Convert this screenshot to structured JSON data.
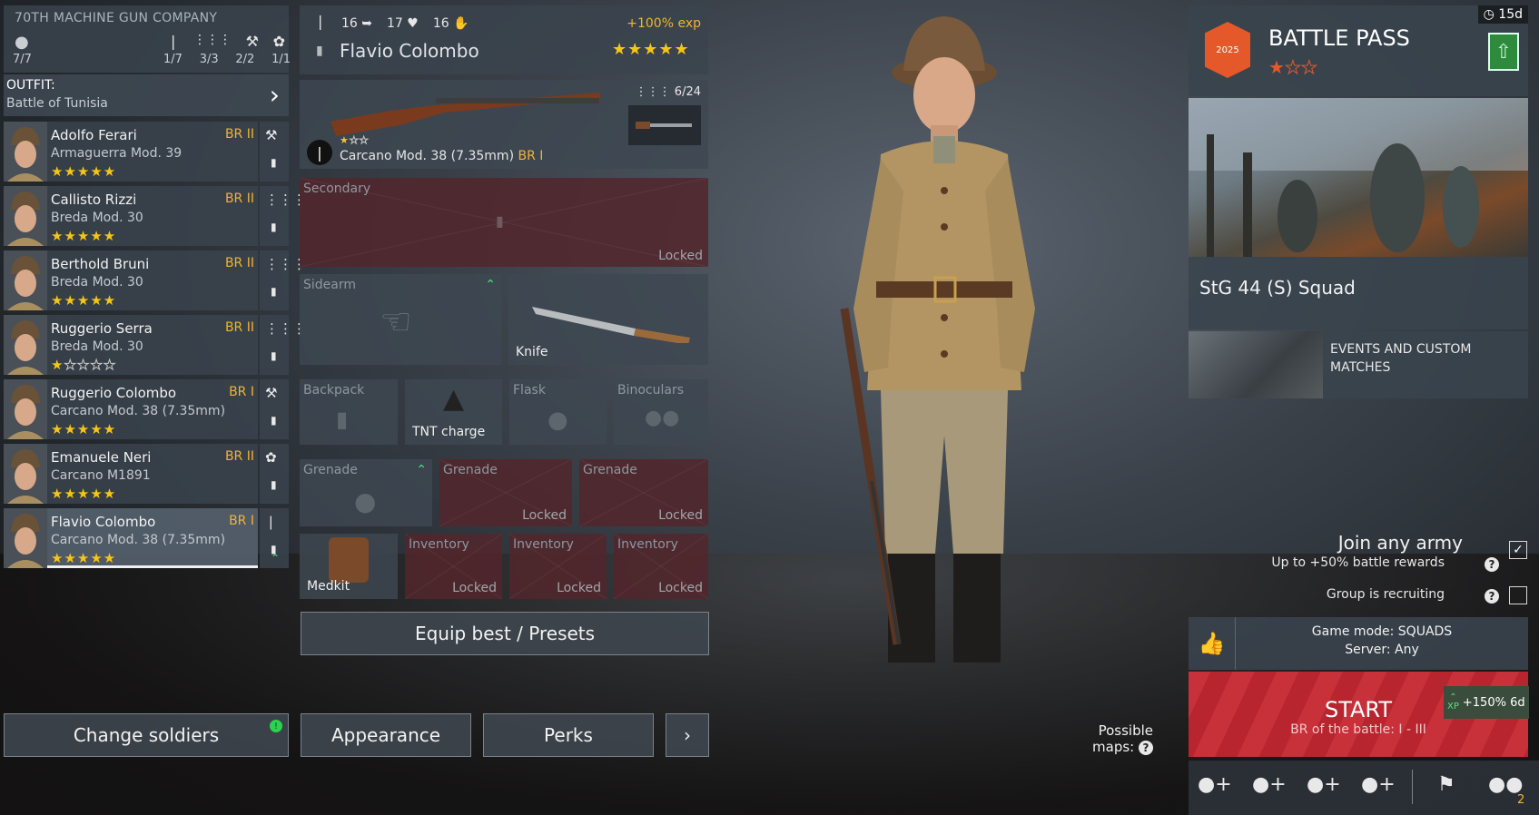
{
  "company": {
    "name": "70TH MACHINE GUN COMPANY",
    "soldiers_count": "7/7",
    "stats": [
      "1/7",
      "3/3",
      "2/2",
      "1/1"
    ]
  },
  "outfit": {
    "label": "OUTFIT:",
    "value": "Battle of Tunisia"
  },
  "soldiers": [
    {
      "name": "Adolfo Ferari",
      "weapon": "Armaguerra Mod. 39",
      "br": "BR II",
      "stars": 5,
      "icon": "wrench-icon"
    },
    {
      "name": "Callisto Rizzi",
      "weapon": "Breda Mod. 30",
      "br": "BR II",
      "stars": 5,
      "icon": "ammo-icon"
    },
    {
      "name": "Berthold Bruni",
      "weapon": "Breda Mod. 30",
      "br": "BR II",
      "stars": 5,
      "icon": "ammo-icon"
    },
    {
      "name": "Ruggerio Serra",
      "weapon": "Breda Mod. 30",
      "br": "BR II",
      "stars": 1,
      "icon": "ammo-icon"
    },
    {
      "name": "Ruggerio Colombo",
      "weapon": "Carcano Mod. 38 (7.35mm)",
      "br": "BR I",
      "stars": 5,
      "icon": "wrench-icon"
    },
    {
      "name": "Emanuele Neri",
      "weapon": "Carcano M1891",
      "br": "BR II",
      "stars": 5,
      "icon": "flame-icon"
    },
    {
      "name": "Flavio Colombo",
      "weapon": "Carcano Mod. 38 (7.35mm)",
      "br": "BR I",
      "stars": 5,
      "icon": "bullet-icon"
    }
  ],
  "selected": {
    "stat1": "16",
    "stat2": "17",
    "stat3": "16",
    "exp_bonus": "+100% exp",
    "name": "Flavio Colombo"
  },
  "primary": {
    "ammo": "6/24",
    "name": "Carcano Mod. 38 (7.35mm)",
    "br": "BR I"
  },
  "slots": {
    "secondary": "Secondary",
    "locked": "Locked",
    "sidearm": "Sidearm",
    "knife": "Knife",
    "backpack": "Backpack",
    "tnt": "TNT charge",
    "flask": "Flask",
    "binoculars": "Binoculars",
    "grenade": "Grenade",
    "medkit": "Medkit",
    "inventory": "Inventory"
  },
  "buttons": {
    "equip_best": "Equip best / Presets",
    "change_soldiers": "Change soldiers",
    "appearance": "Appearance",
    "perks": "Perks"
  },
  "battle_pass": {
    "timer": "15d",
    "title": "BATTLE PASS",
    "emblem": "2025",
    "stars_filled": 1,
    "stars_total": 3,
    "squad": "StG 44 (S) Squad"
  },
  "events": {
    "label": "EVENTS AND CUSTOM MATCHES"
  },
  "join": {
    "title": "Join any army",
    "subtitle": "Up to +50% battle rewards",
    "recruiting": "Group is recruiting"
  },
  "game": {
    "mode": "Game mode: SQUADS",
    "server": "Server: Any"
  },
  "start": {
    "label": "START",
    "br": "BR of the battle: I - III",
    "xp_bonus": "+150% 6d",
    "xp_label": "XP"
  },
  "maps": {
    "line1": "Possible",
    "line2": "maps:"
  },
  "party": {
    "count": "2"
  },
  "colors": {
    "accent": "#f2b234",
    "start": "#c8303a",
    "locked": "#52262c"
  }
}
